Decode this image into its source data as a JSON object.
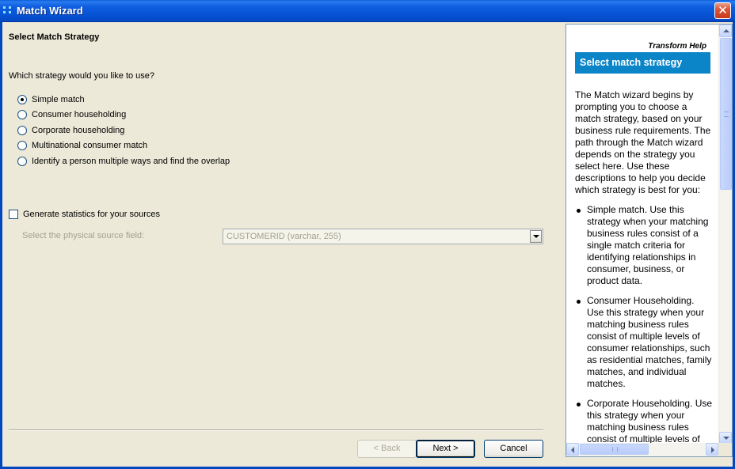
{
  "window": {
    "title": "Match Wizard",
    "close_symbol": "✕"
  },
  "page": {
    "heading": "Select Match Strategy",
    "question": "Which strategy would you like to use?"
  },
  "strategies": [
    {
      "label": "Simple match",
      "checked": true
    },
    {
      "label": "Consumer householding",
      "checked": false
    },
    {
      "label": "Corporate householding",
      "checked": false
    },
    {
      "label": "Multinational consumer match",
      "checked": false
    },
    {
      "label": "Identify a person multiple ways and find the overlap",
      "checked": false
    }
  ],
  "statistics": {
    "checkbox_label": "Generate statistics for your sources",
    "checked": false,
    "field_label": "Select the physical source field:",
    "field_value": "CUSTOMERID (varchar, 255)"
  },
  "buttons": {
    "back": "< Back",
    "next": "Next >",
    "cancel": "Cancel"
  },
  "help": {
    "brand": "Transform Help",
    "title": "Select match strategy",
    "title_color": "#0B85C7",
    "intro": "The Match wizard begins by prompting you to choose a match strategy, based on your business rule requirements. The path through the Match wizard depends on the strategy you select here. Use these descriptions to help you decide which strategy is best for you:",
    "items": [
      "Simple match. Use this strategy when your matching business rules consist of a single match criteria for identifying relationships in consumer, business, or product data.",
      "Consumer Householding. Use this strategy when your matching business rules consist of multiple levels of consumer relationships, such as residential matches, family matches, and individual matches.",
      "Corporate Householding. Use this strategy when your matching business rules consist of multiple levels of"
    ]
  },
  "icons": {
    "app": "match-wizard-app-icon",
    "close": "close-icon",
    "dropdown": "chevron-down-icon"
  }
}
